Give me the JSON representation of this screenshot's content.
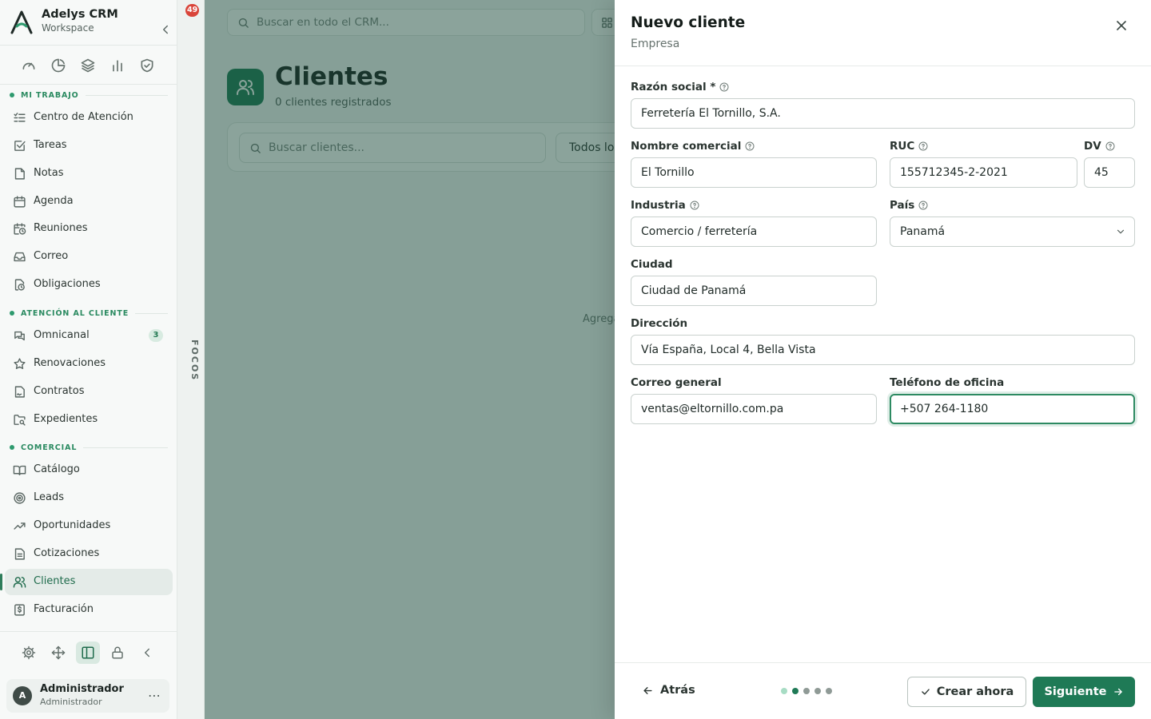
{
  "app": {
    "name": "Adelys CRM",
    "workspace": "Workspace",
    "notifications_count": "49",
    "focus_label": "FOCOS",
    "accent_color": "#1f7a56"
  },
  "sidebar": {
    "quick_icons": [
      "dashboard-icon",
      "pie-chart-icon",
      "layers-icon",
      "bar-chart-icon",
      "shield-check-icon"
    ],
    "sections": [
      {
        "title": "MI TRABAJO",
        "items": [
          {
            "label": "Centro de Atención",
            "icon": "list-todo-icon"
          },
          {
            "label": "Tareas",
            "icon": "checkbox-icon"
          },
          {
            "label": "Notas",
            "icon": "note-icon"
          },
          {
            "label": "Agenda",
            "icon": "calendar-icon"
          },
          {
            "label": "Reuniones",
            "icon": "calendar-clock-icon"
          },
          {
            "label": "Correo",
            "icon": "inbox-icon"
          },
          {
            "label": "Obligaciones",
            "icon": "file-clock-icon"
          }
        ]
      },
      {
        "title": "ATENCIÓN AL CLIENTE",
        "items": [
          {
            "label": "Omnicanal",
            "icon": "chat-icon",
            "badge": "3"
          },
          {
            "label": "Renovaciones",
            "icon": "star-icon"
          },
          {
            "label": "Contratos",
            "icon": "contract-icon"
          },
          {
            "label": "Expedientes",
            "icon": "folder-search-icon"
          }
        ]
      },
      {
        "title": "COMERCIAL",
        "items": [
          {
            "label": "Catálogo",
            "icon": "book-icon"
          },
          {
            "label": "Leads",
            "icon": "target-icon"
          },
          {
            "label": "Oportunidades",
            "icon": "trending-up-icon"
          },
          {
            "label": "Cotizaciones",
            "icon": "document-icon"
          },
          {
            "label": "Clientes",
            "icon": "users-icon",
            "active": true
          },
          {
            "label": "Facturación",
            "icon": "invoice-icon"
          }
        ]
      }
    ],
    "bottom_tools": [
      "settings-icon",
      "move-icon",
      "panel-icon",
      "lock-icon",
      "chevron-left-icon"
    ],
    "user": {
      "initial": "A",
      "name": "Administrador",
      "role": "Administrador"
    }
  },
  "main": {
    "global_search_placeholder": "Buscar en todo el CRM...",
    "page_title": "Clientes",
    "page_subtitle": "0 clientes registrados",
    "client_search_placeholder": "Buscar clientes...",
    "filter_value": "Todos los",
    "empty_hint": "Agrega"
  },
  "drawer": {
    "title": "Nuevo cliente",
    "subtitle": "Empresa",
    "fields": {
      "razon_social": {
        "label": "Razón social *",
        "value": "Ferretería El Tornillo, S.A."
      },
      "nombre_comercial": {
        "label": "Nombre comercial",
        "value": "El Tornillo"
      },
      "ruc": {
        "label": "RUC",
        "value": "155712345-2-2021"
      },
      "dv": {
        "label": "DV",
        "value": "45"
      },
      "industria": {
        "label": "Industria",
        "value": "Comercio / ferretería"
      },
      "pais": {
        "label": "País",
        "value": "Panamá"
      },
      "ciudad": {
        "label": "Ciudad",
        "value": "Ciudad de Panamá"
      },
      "direccion": {
        "label": "Dirección",
        "value": "Vía España, Local 4, Bella Vista"
      },
      "correo": {
        "label": "Correo general",
        "value": "ventas@eltornillo.com.pa"
      },
      "telefono": {
        "label": "Teléfono de oficina",
        "value": "+507 264-1180"
      }
    },
    "footer": {
      "back_label": "Atrás",
      "steps_total": 5,
      "current_step": 2,
      "create_label": "Crear ahora",
      "next_label": "Siguiente"
    }
  }
}
